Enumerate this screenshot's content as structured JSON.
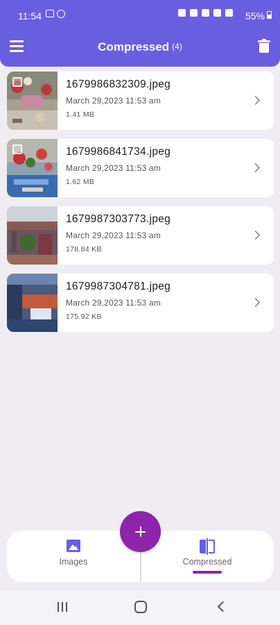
{
  "status_bar": {
    "time": "11:54",
    "battery": "55%",
    "left_icons": [
      "gallery-icon",
      "data-saver-icon"
    ],
    "right_icons": [
      "notification-icon",
      "alarm-icon",
      "mute-icon",
      "wifi-icon",
      "signal-icon"
    ]
  },
  "app_bar": {
    "title": "Compressed",
    "count": "(4)",
    "menu_icon": "hamburger-menu-icon",
    "delete_icon": "trash-icon"
  },
  "files": [
    {
      "name": "1679986832309.jpeg",
      "date": "March 29,2023 11:53 am",
      "size": "1.41 MB"
    },
    {
      "name": "1679986841734.jpeg",
      "date": "March 29,2023 11:53 am",
      "size": "1.62 MB"
    },
    {
      "name": "1679987303773.jpeg",
      "date": "March 29,2023 11:53 am",
      "size": "178.84 KB"
    },
    {
      "name": "1679987304781.jpeg",
      "date": "March 29,2023 11:53 am",
      "size": "175.92 KB"
    }
  ],
  "bottom_nav": {
    "images_label": "Images",
    "compressed_label": "Compressed",
    "active_tab": "compressed",
    "fab_icon": "plus-icon"
  },
  "colors": {
    "primary": "#6a5ee0",
    "accent": "#8e24aa"
  }
}
